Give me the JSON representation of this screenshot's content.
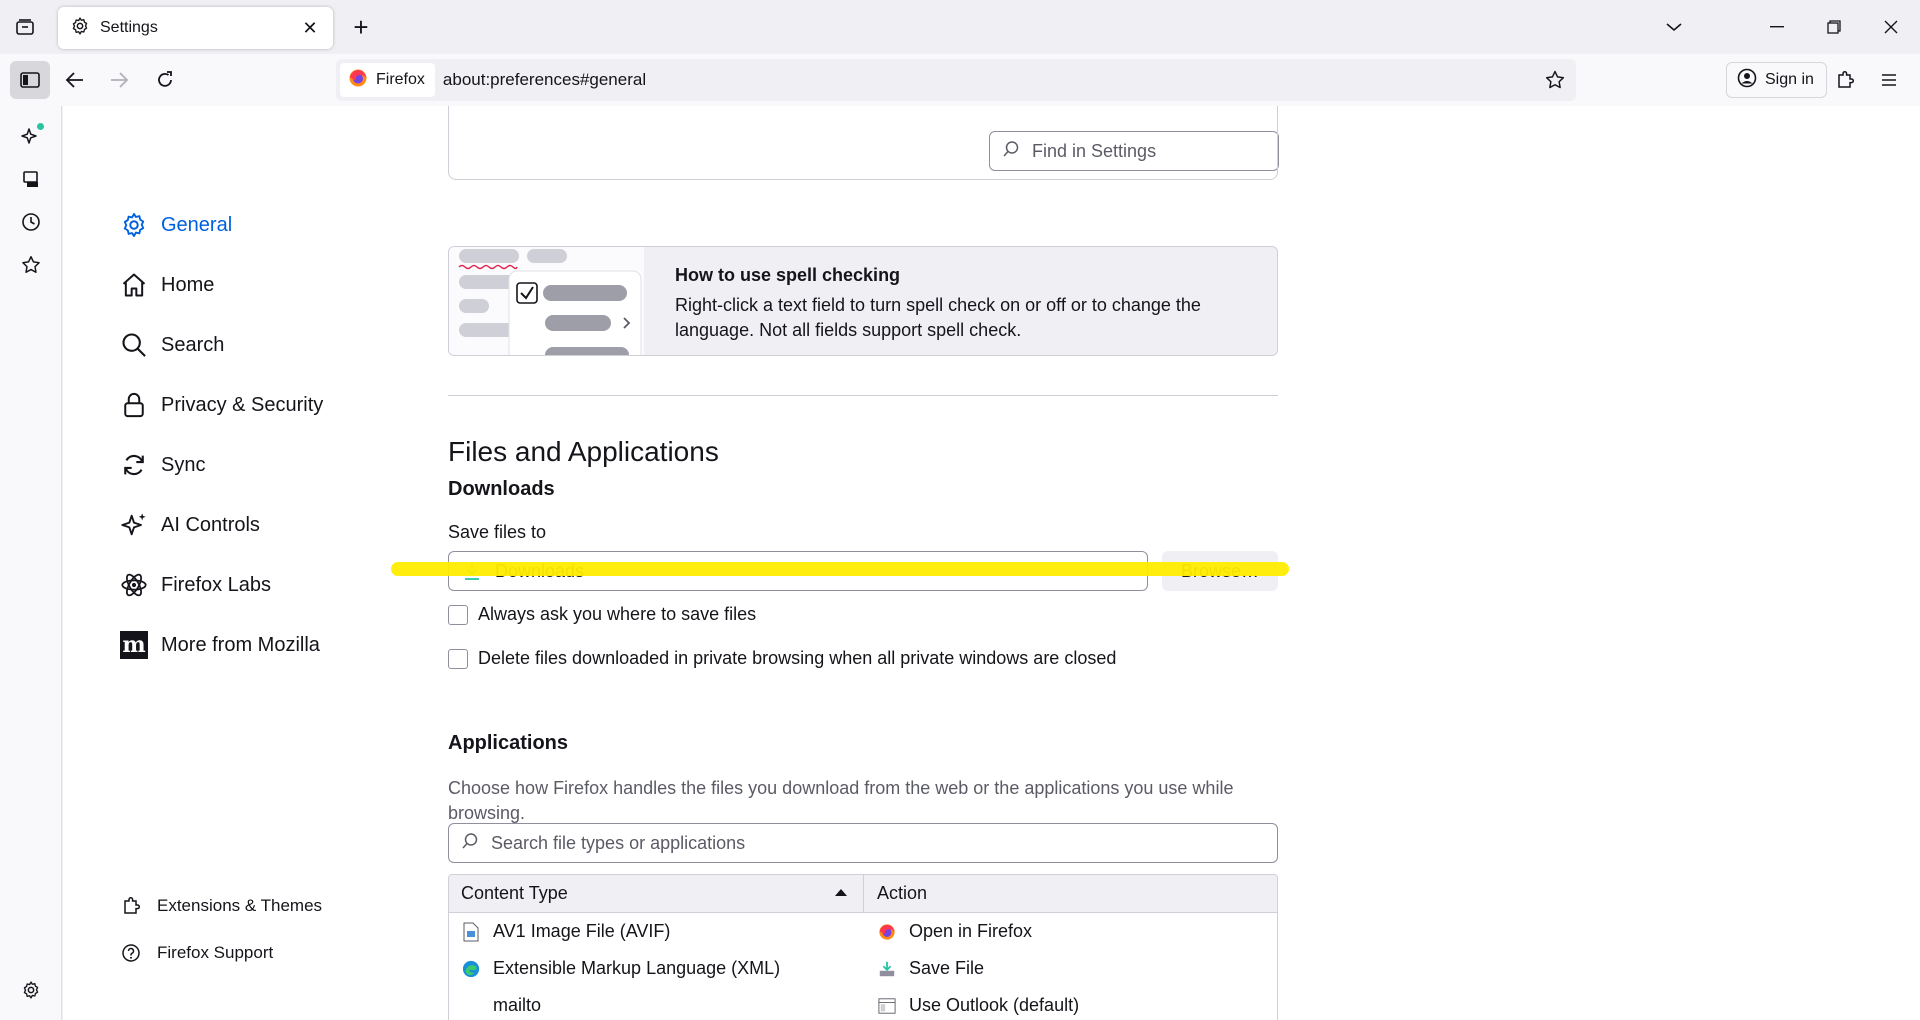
{
  "tab": {
    "title": "Settings"
  },
  "urlbar": {
    "identity_label": "Firefox",
    "url": "about:preferences#general"
  },
  "toolbar": {
    "signin_label": "Sign in"
  },
  "find": {
    "placeholder": "Find in Settings"
  },
  "categories": [
    {
      "label": "General",
      "icon": "gear-icon",
      "selected": true
    },
    {
      "label": "Home",
      "icon": "home-icon"
    },
    {
      "label": "Search",
      "icon": "search-icon"
    },
    {
      "label": "Privacy & Security",
      "icon": "lock-icon"
    },
    {
      "label": "Sync",
      "icon": "sync-icon"
    },
    {
      "label": "AI Controls",
      "icon": "sparkle-icon"
    },
    {
      "label": "Firefox Labs",
      "icon": "atom-icon"
    },
    {
      "label": "More from Mozilla",
      "icon": "mozilla-logo-icon"
    }
  ],
  "footer": {
    "extensions_label": "Extensions & Themes",
    "support_label": "Firefox Support"
  },
  "spell": {
    "title": "How to use spell checking",
    "description": "Right-click a text field to turn spell check on or off or to change the language. Not all fields support spell check."
  },
  "files": {
    "heading": "Files and Applications",
    "downloads_heading": "Downloads",
    "save_label": "Save files to",
    "folder": "Downloads",
    "browse_label": "Browse…",
    "always_ask": "Always ask you where to save files",
    "delete_private": "Delete files downloaded in private browsing when all private windows are closed",
    "always_ask_checked": false,
    "delete_private_checked": false
  },
  "applications": {
    "heading": "Applications",
    "description": "Choose how Firefox handles the files you download from the web or the applications you use while browsing.",
    "search_placeholder": "Search file types or applications",
    "columns": [
      "Content Type",
      "Action"
    ],
    "rows": [
      {
        "type": "AV1 Image File (AVIF)",
        "type_icon": "image-file-icon",
        "action": "Open in Firefox",
        "action_icon": "firefox-icon"
      },
      {
        "type": "Extensible Markup Language (XML)",
        "type_icon": "edge-icon",
        "action": "Save File",
        "action_icon": "save-file-icon"
      },
      {
        "type": "mailto",
        "type_icon": "",
        "action": "Use Outlook (default)",
        "action_icon": "outlook-window-icon"
      }
    ]
  },
  "colors": {
    "accent": "#0061e0",
    "highlight": "#ffec00",
    "download_green": "#2ac3a2"
  }
}
